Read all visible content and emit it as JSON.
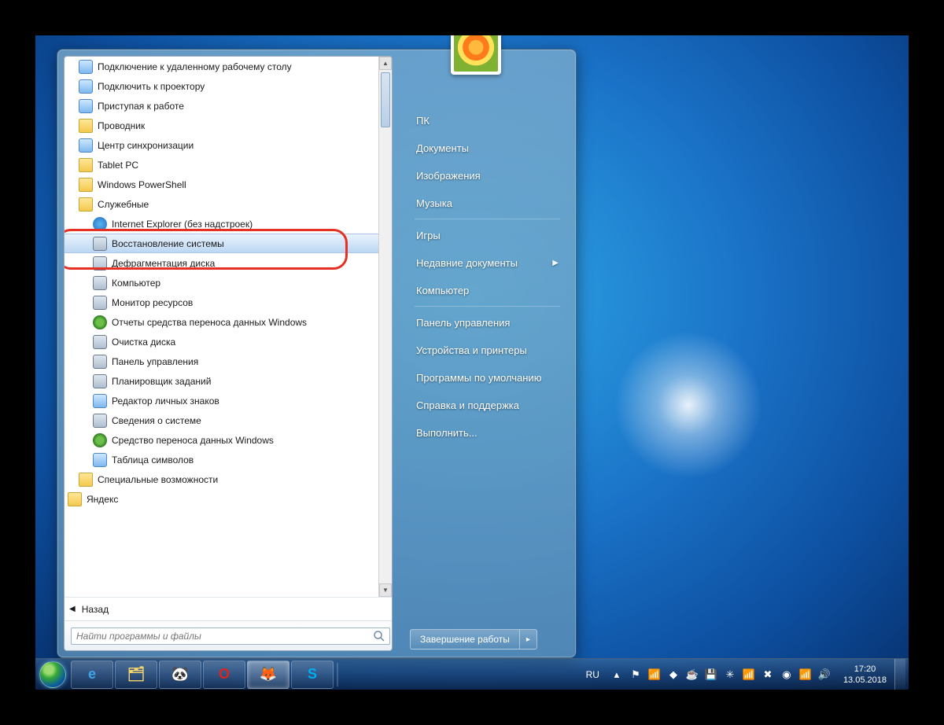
{
  "start_menu": {
    "left": {
      "items": [
        {
          "label": "Подключение к удаленному рабочему столу",
          "icon": "app",
          "indent": 1
        },
        {
          "label": "Подключить к проектору",
          "icon": "app",
          "indent": 1
        },
        {
          "label": "Приступая к работе",
          "icon": "app",
          "indent": 1
        },
        {
          "label": "Проводник",
          "icon": "folder",
          "indent": 1
        },
        {
          "label": "Центр синхронизации",
          "icon": "app",
          "indent": 1
        },
        {
          "label": "Tablet PC",
          "icon": "folder",
          "indent": 1
        },
        {
          "label": "Windows PowerShell",
          "icon": "folder",
          "indent": 1
        },
        {
          "label": "Служебные",
          "icon": "folder",
          "indent": 1
        },
        {
          "label": "Internet Explorer (без надстроек)",
          "icon": "ie",
          "indent": 2
        },
        {
          "label": "Восстановление системы",
          "icon": "sys",
          "indent": 2,
          "selected": true
        },
        {
          "label": "Дефрагментация диска",
          "icon": "sys",
          "indent": 2
        },
        {
          "label": "Компьютер",
          "icon": "sys",
          "indent": 2
        },
        {
          "label": "Монитор ресурсов",
          "icon": "sys",
          "indent": 2
        },
        {
          "label": "Отчеты средства переноса данных Windows",
          "icon": "globe",
          "indent": 2
        },
        {
          "label": "Очистка диска",
          "icon": "sys",
          "indent": 2
        },
        {
          "label": "Панель управления",
          "icon": "sys",
          "indent": 2
        },
        {
          "label": "Планировщик заданий",
          "icon": "sys",
          "indent": 2
        },
        {
          "label": "Редактор личных знаков",
          "icon": "app",
          "indent": 2
        },
        {
          "label": "Сведения о системе",
          "icon": "sys",
          "indent": 2
        },
        {
          "label": "Средство переноса данных Windows",
          "icon": "globe",
          "indent": 2
        },
        {
          "label": "Таблица символов",
          "icon": "app",
          "indent": 2
        },
        {
          "label": "Специальные возможности",
          "icon": "folder",
          "indent": 1
        },
        {
          "label": "Яндекс",
          "icon": "folder",
          "indent": 0
        }
      ],
      "back_label": "Назад",
      "search_placeholder": "Найти программы и файлы"
    },
    "right": {
      "items": [
        {
          "label": "ПК"
        },
        {
          "label": "Документы"
        },
        {
          "label": "Изображения"
        },
        {
          "label": "Музыка"
        },
        {
          "sep": true
        },
        {
          "label": "Игры"
        },
        {
          "label": "Недавние документы",
          "submenu": true
        },
        {
          "label": "Компьютер"
        },
        {
          "sep": true
        },
        {
          "label": "Панель управления"
        },
        {
          "label": "Устройства и принтеры"
        },
        {
          "label": "Программы по умолчанию"
        },
        {
          "label": "Справка и поддержка"
        },
        {
          "label": "Выполнить..."
        }
      ],
      "shutdown_label": "Завершение работы"
    }
  },
  "taskbar": {
    "lang": "RU",
    "time": "17:20",
    "date": "13.05.2018",
    "pinned": [
      {
        "name": "ie",
        "glyph": "e",
        "color": "#3fa2e8"
      },
      {
        "name": "explorer",
        "glyph": "🗂",
        "color": "#f6d36b"
      },
      {
        "name": "panda",
        "glyph": "🐼",
        "color": "#ffffff"
      },
      {
        "name": "opera",
        "glyph": "O",
        "color": "#e2231a"
      },
      {
        "name": "firefox",
        "glyph": "🦊",
        "color": "#ff8a00",
        "active": true
      },
      {
        "name": "skype",
        "glyph": "S",
        "color": "#00aff0"
      }
    ],
    "tray_icons": [
      {
        "name": "tray-up",
        "glyph": "▴"
      },
      {
        "name": "flag",
        "glyph": "⚑"
      },
      {
        "name": "network",
        "glyph": "📶"
      },
      {
        "name": "vidalia",
        "glyph": "◆"
      },
      {
        "name": "java",
        "glyph": "☕"
      },
      {
        "name": "floppy",
        "glyph": "💾"
      },
      {
        "name": "spark",
        "glyph": "✳"
      },
      {
        "name": "signal",
        "glyph": "📶"
      },
      {
        "name": "mute",
        "glyph": "✖"
      },
      {
        "name": "orange",
        "glyph": "◉"
      },
      {
        "name": "wifi",
        "glyph": "📶"
      },
      {
        "name": "volume",
        "glyph": "🔊"
      }
    ]
  }
}
